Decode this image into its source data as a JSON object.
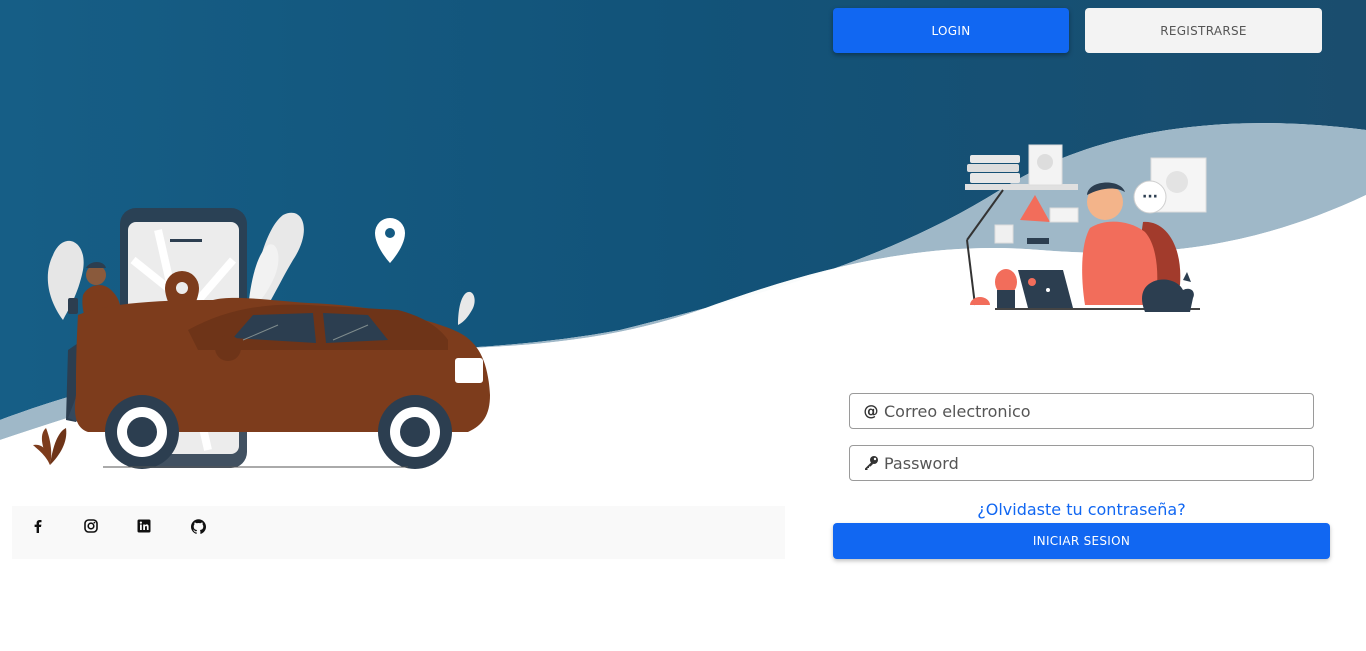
{
  "tabs": {
    "login_label": "LOGIN",
    "register_label": "REGISTRARSE"
  },
  "form": {
    "email_placeholder": "Correo electronico",
    "password_placeholder": "Password",
    "forgot_label": "¿Olvidaste tu contraseña?",
    "submit_label": "INICIAR SESION"
  },
  "social": [
    {
      "icon": "facebook-icon"
    },
    {
      "icon": "instagram-icon"
    },
    {
      "icon": "linkedin-icon"
    },
    {
      "icon": "github-icon"
    }
  ],
  "colors": {
    "primary": "#1167f2",
    "background_dark": "#145a82",
    "car": "#7d3c1c"
  }
}
